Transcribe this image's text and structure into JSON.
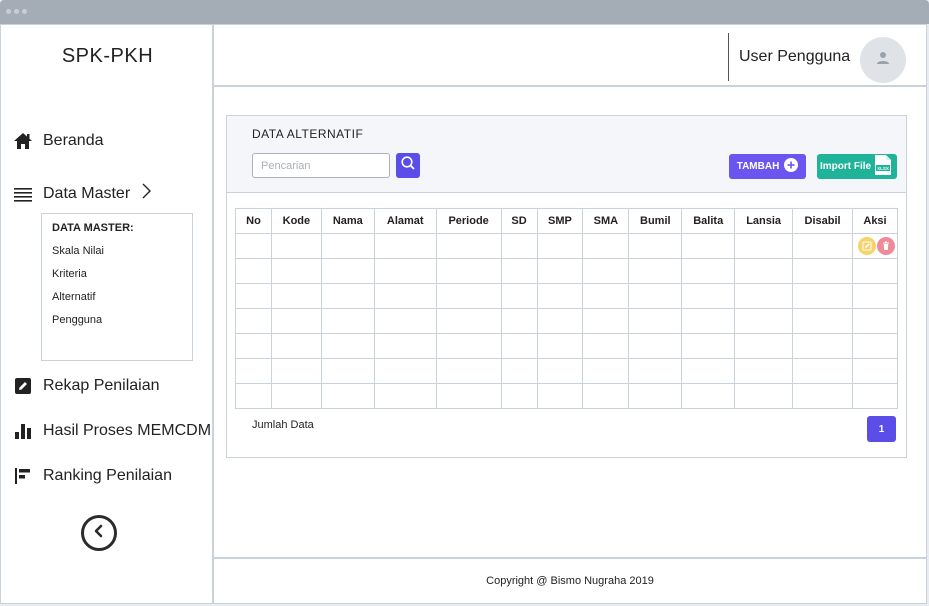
{
  "app": {
    "brand": "SPK-PKH"
  },
  "header": {
    "user_name": "User Pengguna"
  },
  "sidebar": {
    "items": [
      {
        "label": "Beranda",
        "icon": "home-icon"
      },
      {
        "label": "Data Master",
        "icon": "list-icon"
      },
      {
        "label": "Rekap Penilaian",
        "icon": "edit-icon"
      },
      {
        "label": "Hasil Proses MEMCDM",
        "icon": "bar-chart-icon"
      },
      {
        "label": "Ranking Penilaian",
        "icon": "ranking-icon"
      }
    ],
    "submenu": {
      "title": "DATA MASTER:",
      "items": [
        "Skala Nilai",
        "Kriteria",
        "Alternatif",
        "Pengguna"
      ]
    }
  },
  "main": {
    "title": "DATA ALTERNATIF",
    "search": {
      "placeholder": "Pencarian",
      "value": ""
    },
    "add_button": "TAMBAH",
    "import_button": "Import File",
    "import_badge": "XLSX",
    "table": {
      "columns": [
        "No",
        "Kode",
        "Nama",
        "Alamat",
        "Periode",
        "SD",
        "SMP",
        "SMA",
        "Bumil",
        "Balita",
        "Lansia",
        "Disabil",
        "Aksi"
      ],
      "empty_rows": 7
    },
    "jumlah_label": "Jumlah Data",
    "pagination": {
      "current_page": "1"
    }
  },
  "footer": {
    "copyright": "Copyright @ Bismo Nugraha 2019"
  },
  "colors": {
    "primary": "#5b4de8",
    "success": "#1fb39a",
    "edit": "#f6d36b",
    "delete": "#ee8b9a"
  }
}
